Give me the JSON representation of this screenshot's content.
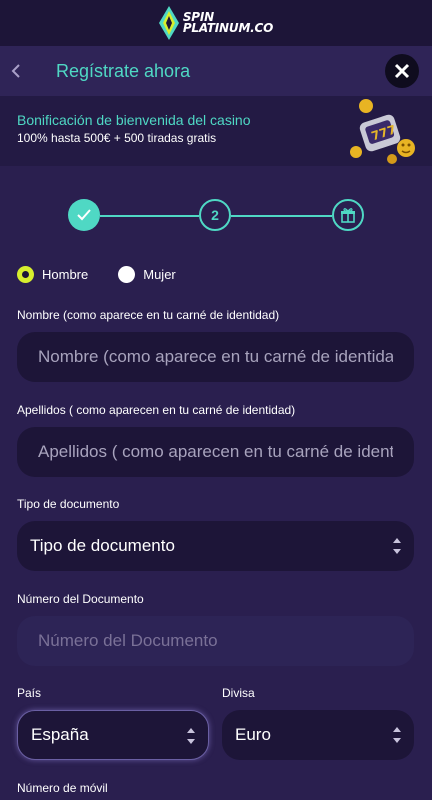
{
  "brand": {
    "line1": "SPIN",
    "line2": "PLATINUM.CO"
  },
  "header": {
    "title": "Regístrate ahora"
  },
  "promo": {
    "title": "Bonificación de bienvenida del casino",
    "subtitle": "100% hasta 500€ + 500 tiradas gratis"
  },
  "stepper": {
    "current_label": "2"
  },
  "gender": {
    "male": "Hombre",
    "female": "Mujer",
    "selected": "Hombre"
  },
  "fields": {
    "first_name": {
      "label": "Nombre (como aparece en tu carné de identidad)",
      "placeholder": "Nombre (como aparece en tu carné de identidad)"
    },
    "last_name": {
      "label": "Apellidos ( como aparecen en tu carné de identidad)",
      "placeholder": "Apellidos ( como aparecen en tu carné de identidad)"
    },
    "doc_type": {
      "label": "Tipo de documento",
      "value": "Tipo de documento"
    },
    "doc_number": {
      "label": "Número del Documento",
      "placeholder": "Número del Documento"
    },
    "country": {
      "label": "País",
      "value": "España"
    },
    "currency": {
      "label": "Divisa",
      "value": "Euro"
    },
    "mobile": {
      "label": "Número de móvil"
    }
  },
  "colors": {
    "accent": "#4fd8c4",
    "radio_selected": "#d7ee2e",
    "background": "#2a1f4f"
  }
}
